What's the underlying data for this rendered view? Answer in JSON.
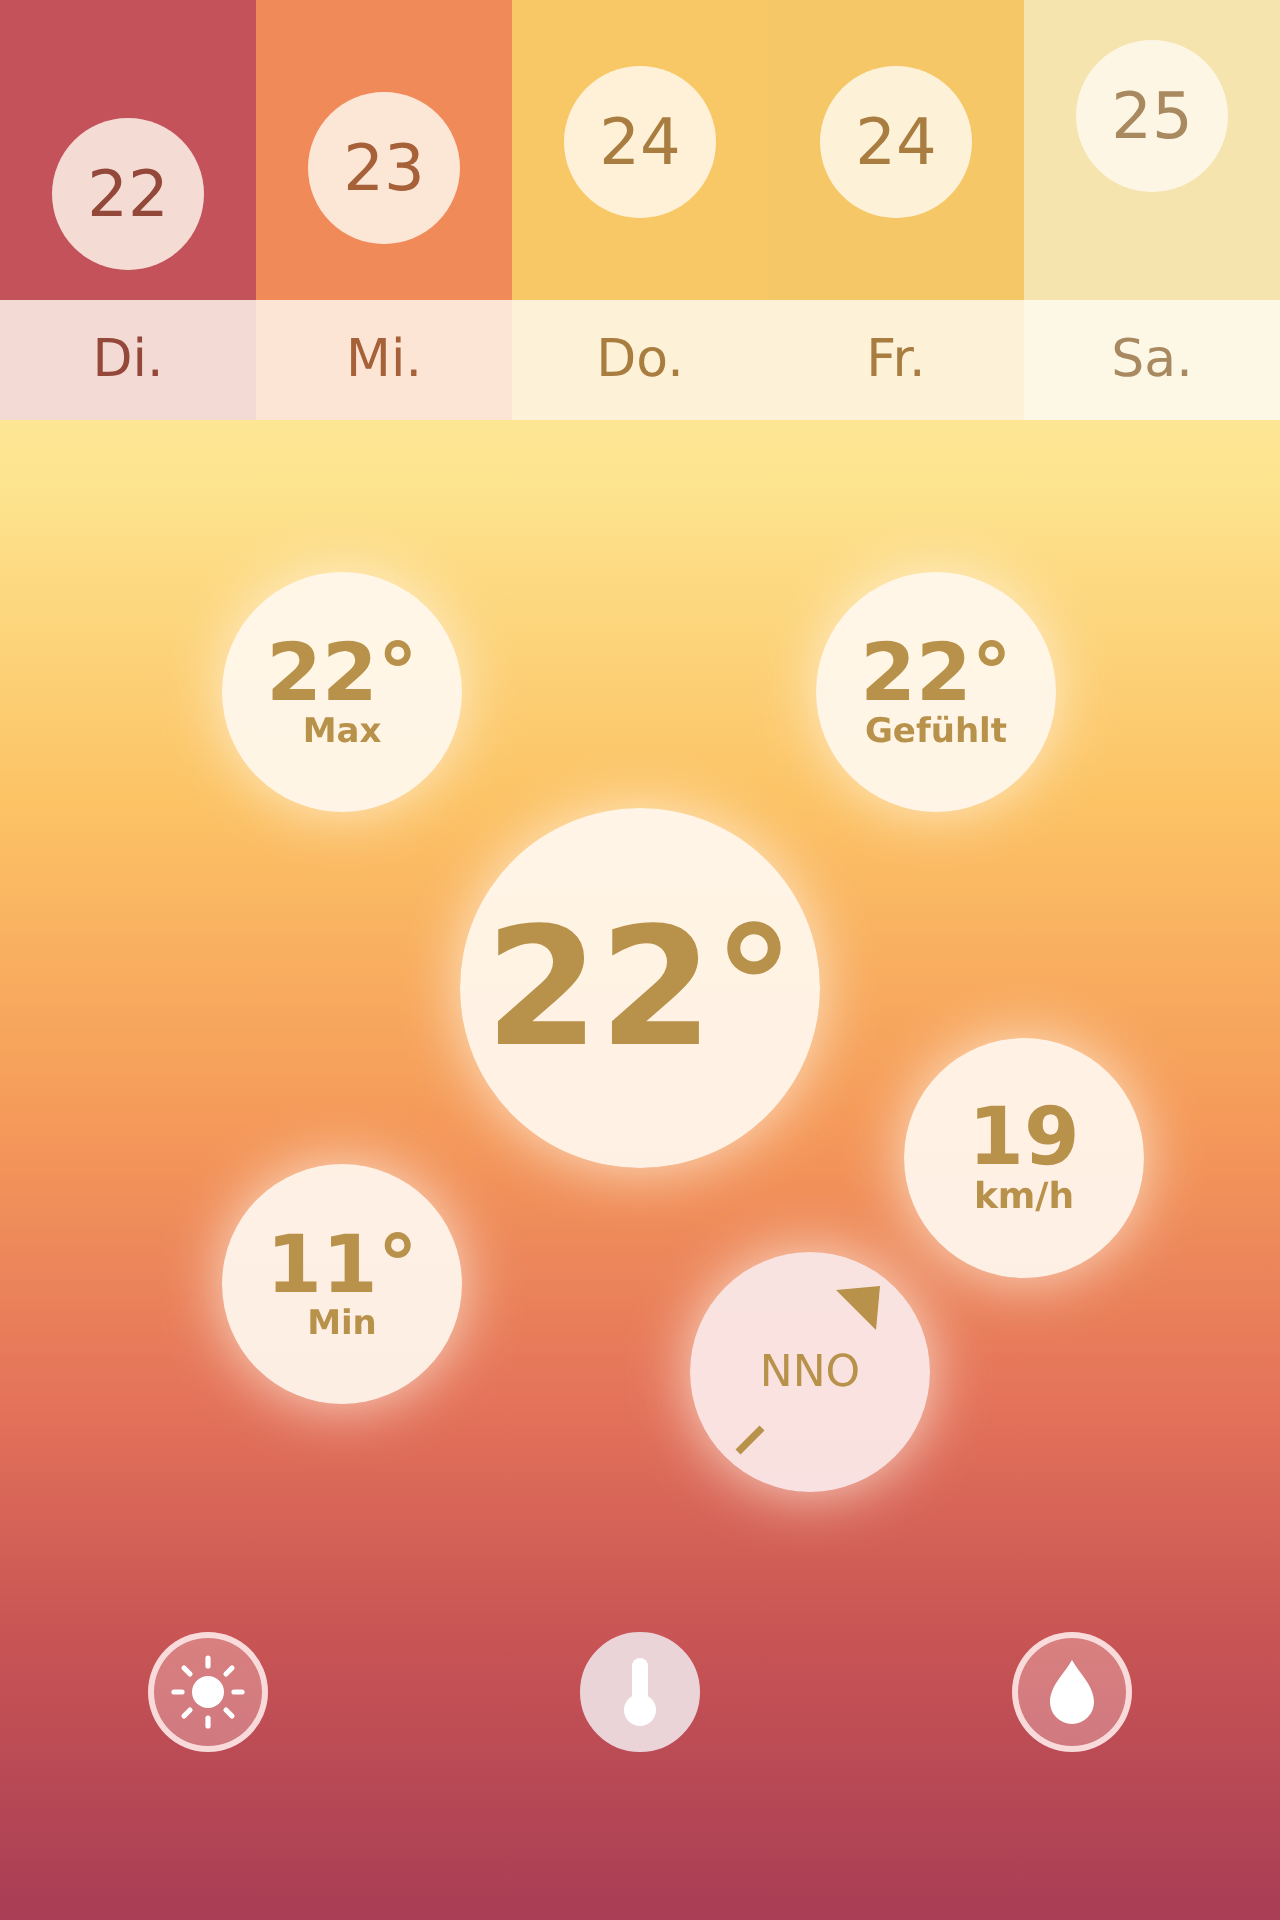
{
  "forecast": [
    {
      "day": "Di.",
      "temp": "22",
      "color": "#c4525a"
    },
    {
      "day": "Mi.",
      "temp": "23",
      "color": "#f08a58"
    },
    {
      "day": "Do.",
      "temp": "24",
      "color": "#f7c865"
    },
    {
      "day": "Fr.",
      "temp": "24",
      "color": "#f5c767"
    },
    {
      "day": "Sa.",
      "temp": "25",
      "color": "#f6e4ae"
    }
  ],
  "current": {
    "temp": "22°"
  },
  "max": {
    "value": "22°",
    "label": "Max"
  },
  "feels_like": {
    "value": "22°",
    "label": "Gefühlt"
  },
  "min": {
    "value": "11°",
    "label": "Min"
  },
  "wind": {
    "speed": "19",
    "unit": "km/h",
    "direction": "NNO"
  },
  "tabs": [
    {
      "kind": "sun",
      "selected": false
    },
    {
      "kind": "thermometer",
      "selected": true
    },
    {
      "kind": "drop",
      "selected": false
    }
  ]
}
